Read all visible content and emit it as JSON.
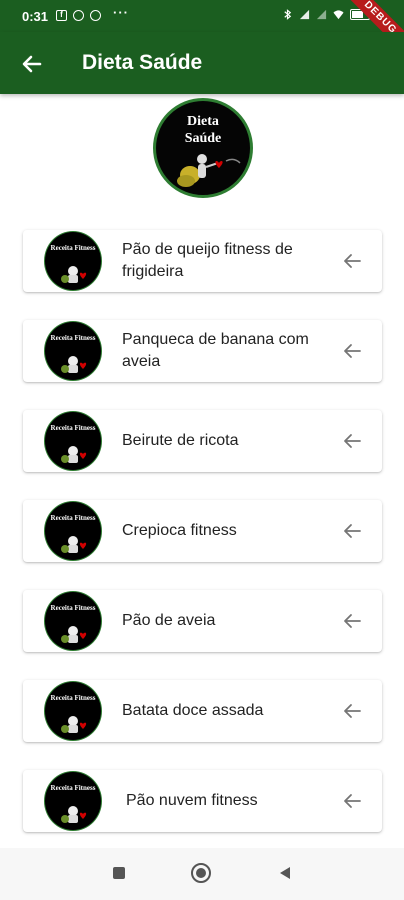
{
  "status": {
    "time": "0:31",
    "debug_label": "DEBUG"
  },
  "app_bar": {
    "title": "Dieta Saúde"
  },
  "logo": {
    "line1": "Dieta",
    "line2": "Saúde"
  },
  "recipes": [
    {
      "label": "Pão de queijo fitness de frigideira",
      "avatar_text": "Receita Fitness"
    },
    {
      "label": "Panqueca de banana com aveia",
      "avatar_text": "Receita Fitness"
    },
    {
      "label": "Beirute de ricota",
      "avatar_text": "Receita Fitness"
    },
    {
      "label": "Crepioca fitness",
      "avatar_text": "Receita Fitness"
    },
    {
      "label": "Pão de aveia",
      "avatar_text": "Receita Fitness"
    },
    {
      "label": "Batata doce assada",
      "avatar_text": "Receita Fitness"
    },
    {
      "label": "Pão nuvem fitness",
      "avatar_text": "Receita Fitness"
    }
  ],
  "colors": {
    "primary": "#1b5e20",
    "accent": "#2e7d32"
  },
  "icons": {
    "back": "arrow-left-icon",
    "item_arrow": "arrow-left-icon"
  }
}
